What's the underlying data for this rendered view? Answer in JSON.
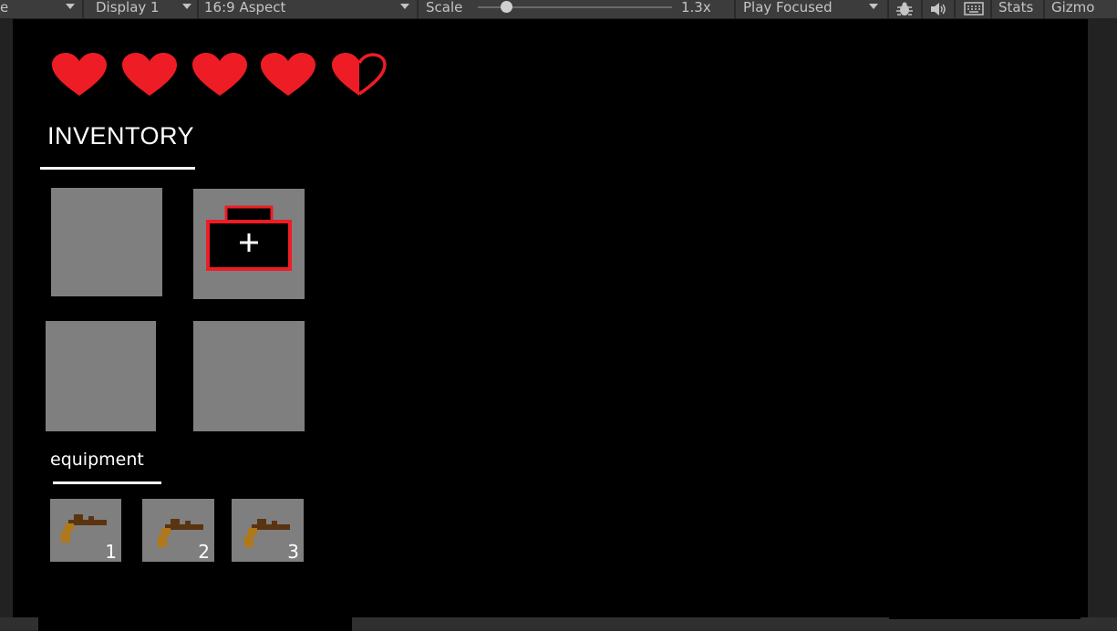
{
  "toolbar": {
    "view_label": "e",
    "display": "Display 1",
    "aspect": "16:9 Aspect",
    "scale_label": "Scale",
    "scale_value": "1.3x",
    "scale_fraction": 0.12,
    "play_mode": "Play Focused",
    "stats_label": "Stats",
    "gizmos_label": "Gizmo"
  },
  "hud": {
    "hearts": {
      "full": 4,
      "half": 1,
      "color": "#ee1c24"
    }
  },
  "inventory": {
    "title": "INVENTORY",
    "slots": [
      "",
      "medkit",
      "",
      ""
    ]
  },
  "equipment": {
    "title": "equipment",
    "slots": [
      {
        "item": "pistol-icon",
        "number": "1"
      },
      {
        "item": "pistol-icon",
        "number": "2"
      },
      {
        "item": "pistol-icon",
        "number": "3"
      }
    ]
  },
  "colors": {
    "slot": "#7f7f7f",
    "medkit_outline": "#ee1c24",
    "gun_barrel": "#5a3410",
    "gun_grip": "#b07818"
  }
}
